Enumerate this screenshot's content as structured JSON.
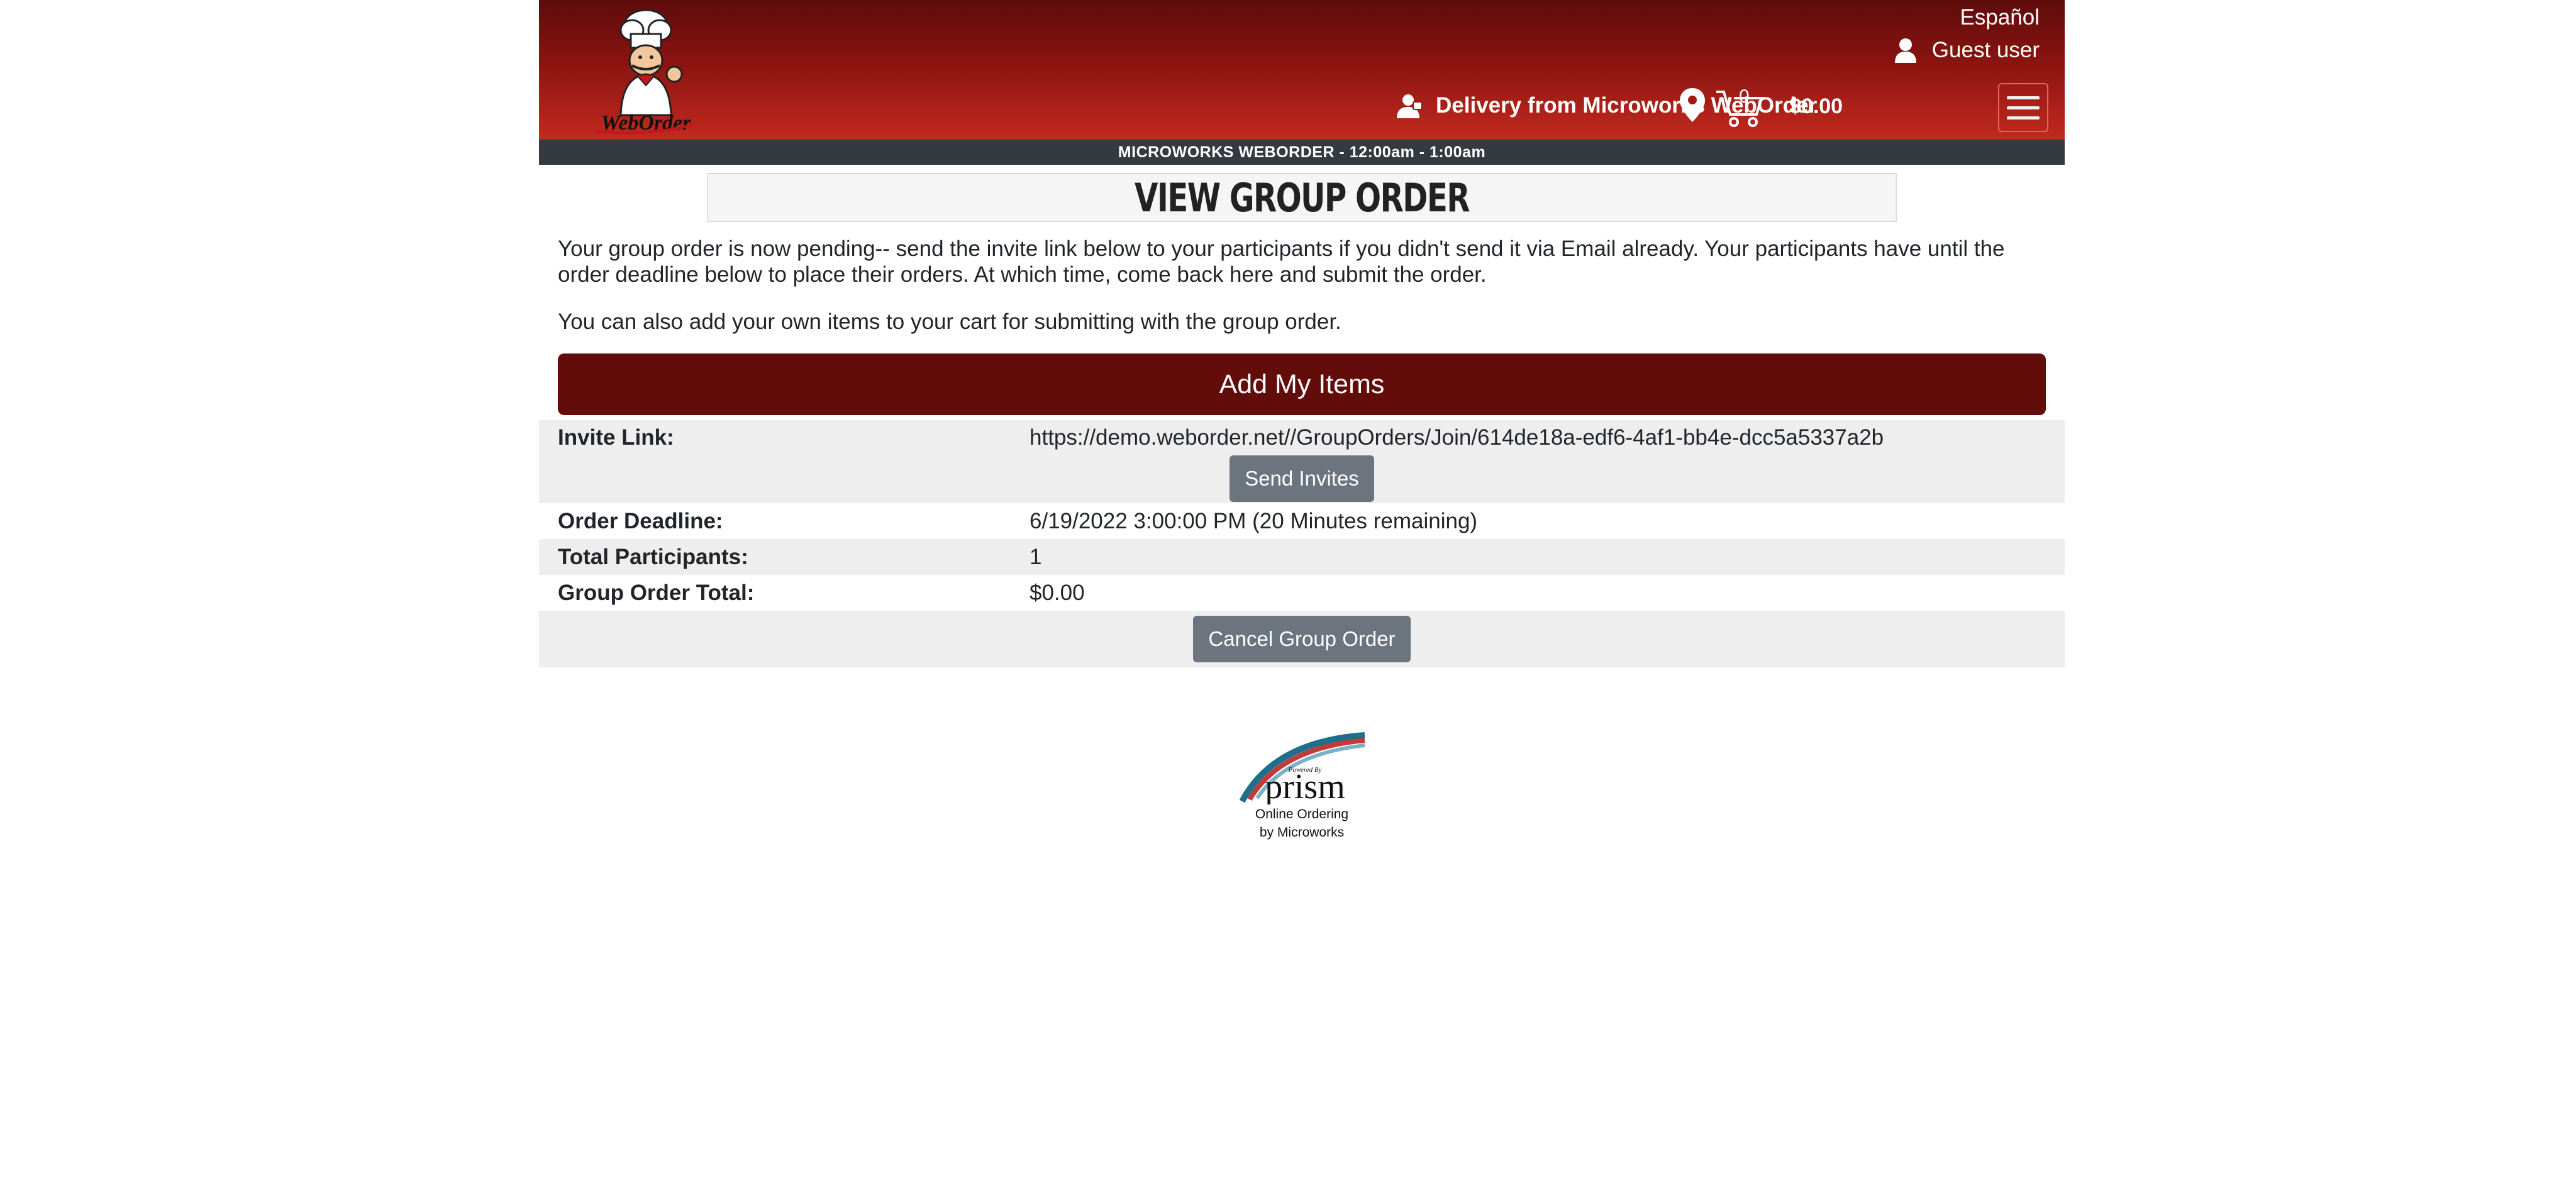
{
  "header": {
    "language_link": "Español",
    "user_label": "Guest user",
    "delivery_label": "Delivery from Microworks WebOrder",
    "cart_count": "0",
    "cart_total": "$0.00",
    "logo_text": "WebOrder"
  },
  "store_bar": "MICROWORKS WEBORDER - 12:00am - 1:00am",
  "page_title": "VIEW GROUP ORDER",
  "messages": {
    "pending": "Your group order is now pending-- send the invite link below to your participants if you didn't send it via Email already. Your participants have until the order deadline below to place their orders. At which time, come back here and submit the order.",
    "own_items": "You can also add your own items to your cart for submitting with the group order."
  },
  "buttons": {
    "add_items": "Add My Items",
    "send_invites": "Send Invites",
    "cancel_group_order": "Cancel Group Order"
  },
  "details": {
    "invite_link_label": "Invite Link:",
    "invite_link_value": "https://demo.weborder.net//GroupOrders/Join/614de18a-edf6-4af1-bb4e-dcc5a5337a2b",
    "deadline_label": "Order Deadline:",
    "deadline_value": "6/19/2022 3:00:00 PM (20 Minutes remaining)",
    "participants_label": "Total Participants:",
    "participants_value": "1",
    "total_label": "Group Order Total:",
    "total_value": "$0.00"
  },
  "footer": {
    "logo_text": "prism",
    "logo_small_text": "Powered By",
    "line1": "Online Ordering",
    "line2": "by Microworks"
  },
  "colors": {
    "header_dark": "#5e0c0c",
    "header_light": "#c32a1f",
    "store_bar": "#343a40",
    "primary_button": "#630d0b",
    "secondary_button": "#6c757d"
  }
}
